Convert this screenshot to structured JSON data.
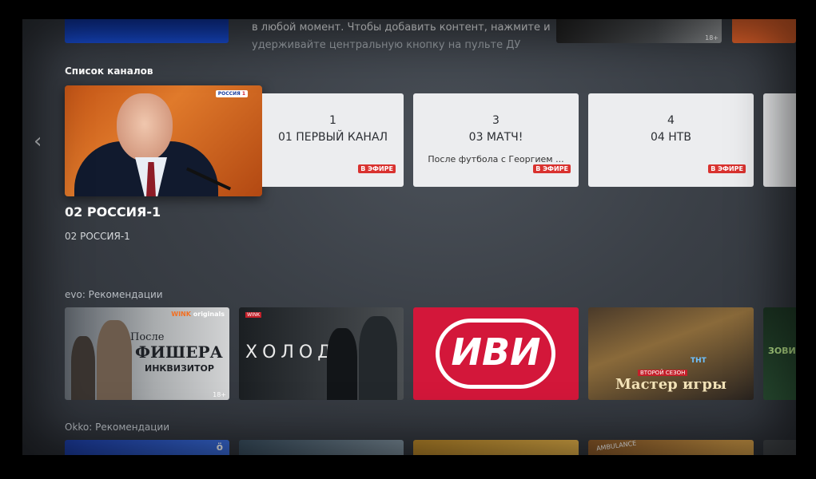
{
  "top": {
    "description_line1": "в любой момент. Чтобы добавить контент, нажмите и",
    "description_line2": "удерживайте центральную кнопку на пульте ДУ",
    "tile_badge": "18+"
  },
  "channels_section": {
    "title": "Список каналов",
    "nav_prev": "‹",
    "focused": {
      "logo_text": "РОССИЯ",
      "logo_num": "1",
      "title": "02 РОССИЯ-1",
      "subtitle": "02 РОССИЯ-1"
    },
    "items": [
      {
        "number": "1",
        "name": "01 ПЕРВЫЙ КАНАЛ",
        "program": "",
        "live": "В ЭФИРЕ"
      },
      {
        "number": "3",
        "name": "03 МАТЧ!",
        "program": "После футбола с Георгием ...",
        "live": "В ЭФИРЕ"
      },
      {
        "number": "4",
        "name": "04 НТВ",
        "program": "",
        "live": "В ЭФИРЕ"
      }
    ]
  },
  "evo_section": {
    "title": "evo: Рекомендации",
    "items": [
      {
        "brand": "WINK",
        "brand_suffix": "originals",
        "title1": "После",
        "title2": "ФИШЕРА",
        "title3": "ИНКВИЗИТОР",
        "badge": "18+"
      },
      {
        "title": "ХОЛОД",
        "tag": "WINK"
      },
      {
        "title": "ИВИ"
      },
      {
        "tag": "ВТОРОЙ СЕЗОН",
        "title": "Мастер игры",
        "channel": "ТНТ"
      },
      {
        "title": "ЗОВИ"
      }
    ]
  },
  "okko_section": {
    "title": "Okko: Рекомендации",
    "items": [
      {
        "label": "ö"
      },
      {
        "label": ""
      },
      {
        "label": ""
      },
      {
        "label": "AMBULANCE"
      },
      {
        "label": ""
      }
    ]
  }
}
